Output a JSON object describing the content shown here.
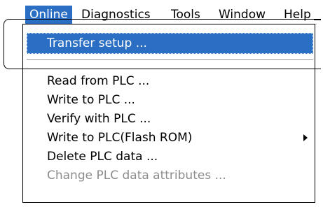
{
  "menubar": {
    "items": [
      "Online",
      "Diagnostics",
      "Tools",
      "Window",
      "Help"
    ]
  },
  "menu": {
    "items": [
      {
        "label": "Transfer setup ...",
        "state": "selected"
      },
      {
        "label": "Read from PLC ...",
        "state": "normal"
      },
      {
        "label": "Write to PLC ...",
        "state": "normal"
      },
      {
        "label": "Verify with PLC ...",
        "state": "normal"
      },
      {
        "label": "Write to PLC(Flash ROM)",
        "state": "normal",
        "submenu": true
      },
      {
        "label": "Delete PLC data ...",
        "state": "normal"
      },
      {
        "label": "Change PLC data attributes ...",
        "state": "disabled"
      }
    ]
  },
  "colors": {
    "highlight": "#2b6fc4",
    "disabled": "#8c8c8c"
  },
  "icons": {
    "submenu_arrow": "chevron-right-icon"
  }
}
